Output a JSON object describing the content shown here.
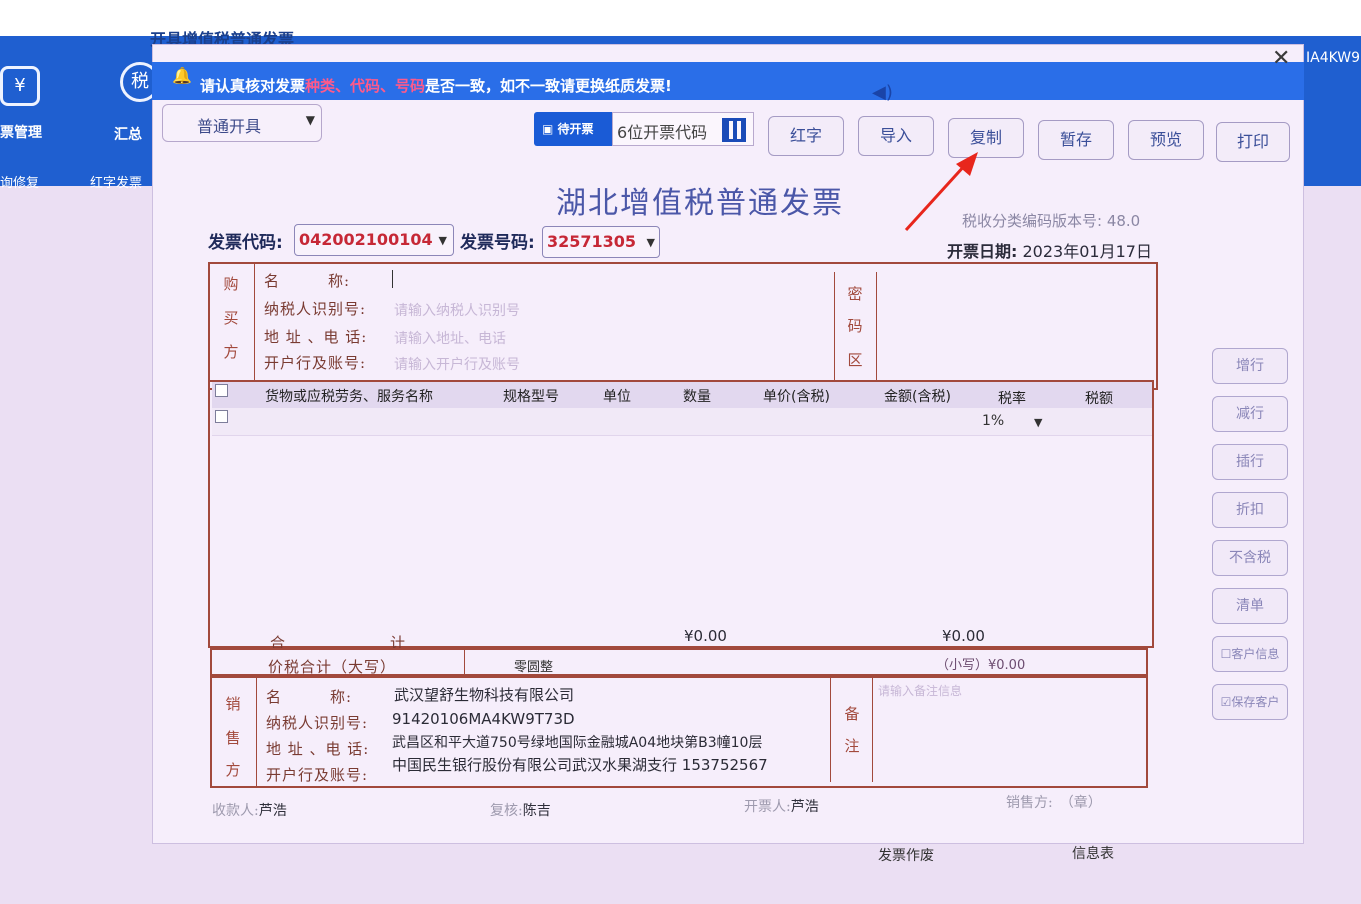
{
  "app": {
    "window_title": "开具增值税普通发票",
    "right_code_fragment": "IA4KW9",
    "sidebar": [
      {
        "label": "票管理",
        "icon": "invoice-manage-icon"
      },
      {
        "label": "汇总",
        "icon": "tax-summary-icon"
      }
    ],
    "bluebar_items": [
      "询修复",
      "红字发票"
    ]
  },
  "notice": {
    "prefix": "请认真核对发票",
    "highlight": "种类、代码、号码",
    "suffix": "是否一致，如不一致请更换纸质发票!"
  },
  "toolbar": {
    "mode_value": "普通开具",
    "pending_label": "待开票",
    "code_placeholder": "6位开票代码",
    "buttons": [
      "红字",
      "导入",
      "复制",
      "暂存",
      "预览",
      "打印"
    ]
  },
  "invoice": {
    "title": "湖北增值税普通发票",
    "version": "税收分类编码版本号: 48.0",
    "date_label": "开票日期:",
    "date_value": "2023年01月17日",
    "code_label": "发票代码:",
    "code_value": "042002100104",
    "number_label": "发票号码:",
    "number_value": "32571305"
  },
  "buyer": {
    "side_label": [
      "购",
      "买",
      "方"
    ],
    "name_label": "名　　　称:",
    "tax_label": "纳税人识别号:",
    "tax_placeholder": "请输入纳税人识别号",
    "addr_label": "地 址 、电 话:",
    "addr_placeholder": "请输入地址、电话",
    "bank_label": "开户行及账号:",
    "bank_placeholder": "请输入开户行及账号",
    "cipher_label": [
      "密",
      "码",
      "区"
    ]
  },
  "items": {
    "headers": [
      "货物或应税劳务、服务名称",
      "规格型号",
      "单位",
      "数量",
      "单价(含税)",
      "金额(含税)",
      "税率",
      "税额"
    ],
    "row_rate": "1%",
    "total_label_1": "合",
    "total_label_2": "计",
    "total_amount": "¥0.00",
    "total_tax": "¥0.00",
    "capital_label": "价税合计（大写）",
    "capital_value": "零圆整",
    "small_label": "（小写）¥0.00"
  },
  "seller": {
    "side_label": [
      "销",
      "售",
      "方"
    ],
    "name_label": "名　　　称:",
    "name_value": "武汉望舒生物科技有限公司",
    "tax_label": "纳税人识别号:",
    "tax_value": "91420106MA4KW9T73D",
    "addr_label": "地 址 、电 话:",
    "addr_value": "武昌区和平大道750号绿地国际金融城A04地块第B3幢10层",
    "bank_label": "开户行及账号:",
    "bank_value": "中国民生银行股份有限公司武汉水果湖支行  153752567",
    "remark_label": [
      "备",
      "注"
    ],
    "remark_placeholder": "请输入备注信息"
  },
  "side_buttons": [
    "增行",
    "减行",
    "插行",
    "折扣",
    "不含税",
    "清单",
    "客户信息",
    "保存客户"
  ],
  "signatures": {
    "payee_label": "收款人:",
    "payee": "芦浩",
    "reviewer_label": "复核:",
    "reviewer": "陈吉",
    "issuer_label": "开票人:",
    "issuer": "芦浩",
    "seller_seal": "销售方:　（章）"
  },
  "footer_links": [
    "发票作废",
    "信息表"
  ]
}
